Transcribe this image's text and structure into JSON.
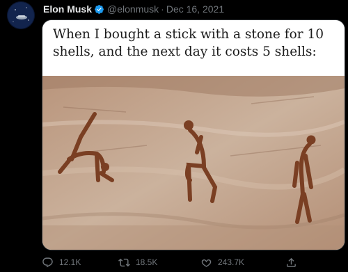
{
  "tweet": {
    "author": {
      "display_name": "Elon Musk",
      "handle": "@elonmusk",
      "separator": "·",
      "date": "Dec 16, 2021",
      "verified": true
    },
    "media": {
      "caption": "When I bought a stick with a stone for 10 shells, and the next day it costs 5 shells:"
    },
    "actions": {
      "replies": "12.1K",
      "retweets": "18.5K",
      "likes": "243.7K"
    },
    "icons": [
      "verified-badge-icon",
      "reply-icon",
      "retweet-icon",
      "like-icon",
      "share-icon"
    ],
    "colors": {
      "background": "#000000",
      "text_primary": "#e7e9ea",
      "text_secondary": "#71767b",
      "verified": "#1d9bf0",
      "border": "#2f3336"
    }
  }
}
